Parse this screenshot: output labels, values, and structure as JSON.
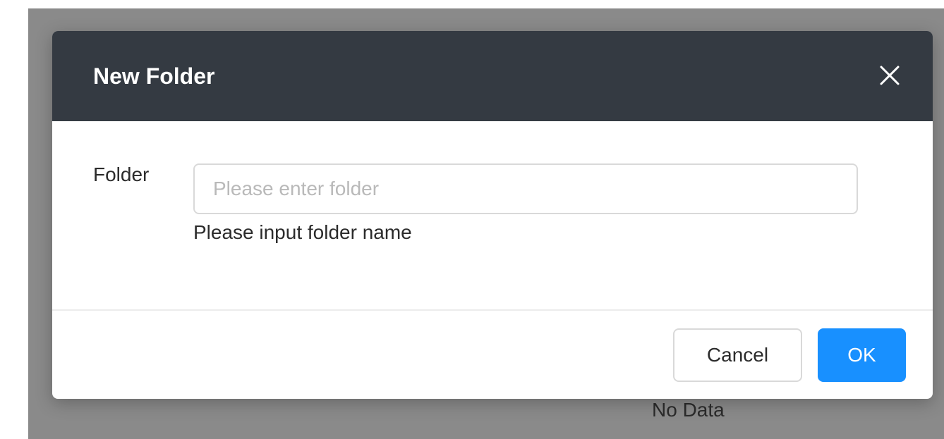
{
  "modal": {
    "title": "New Folder",
    "close_icon": "close-icon",
    "form": {
      "label": "Folder",
      "input_value": "",
      "placeholder": "Please enter folder",
      "help_text": "Please input folder name"
    },
    "footer": {
      "cancel_label": "Cancel",
      "ok_label": "OK"
    }
  },
  "background": {
    "empty_text": "No Data"
  },
  "colors": {
    "header_bg": "#343a42",
    "primary": "#1890ff",
    "overlay": "#8a8a8a"
  }
}
